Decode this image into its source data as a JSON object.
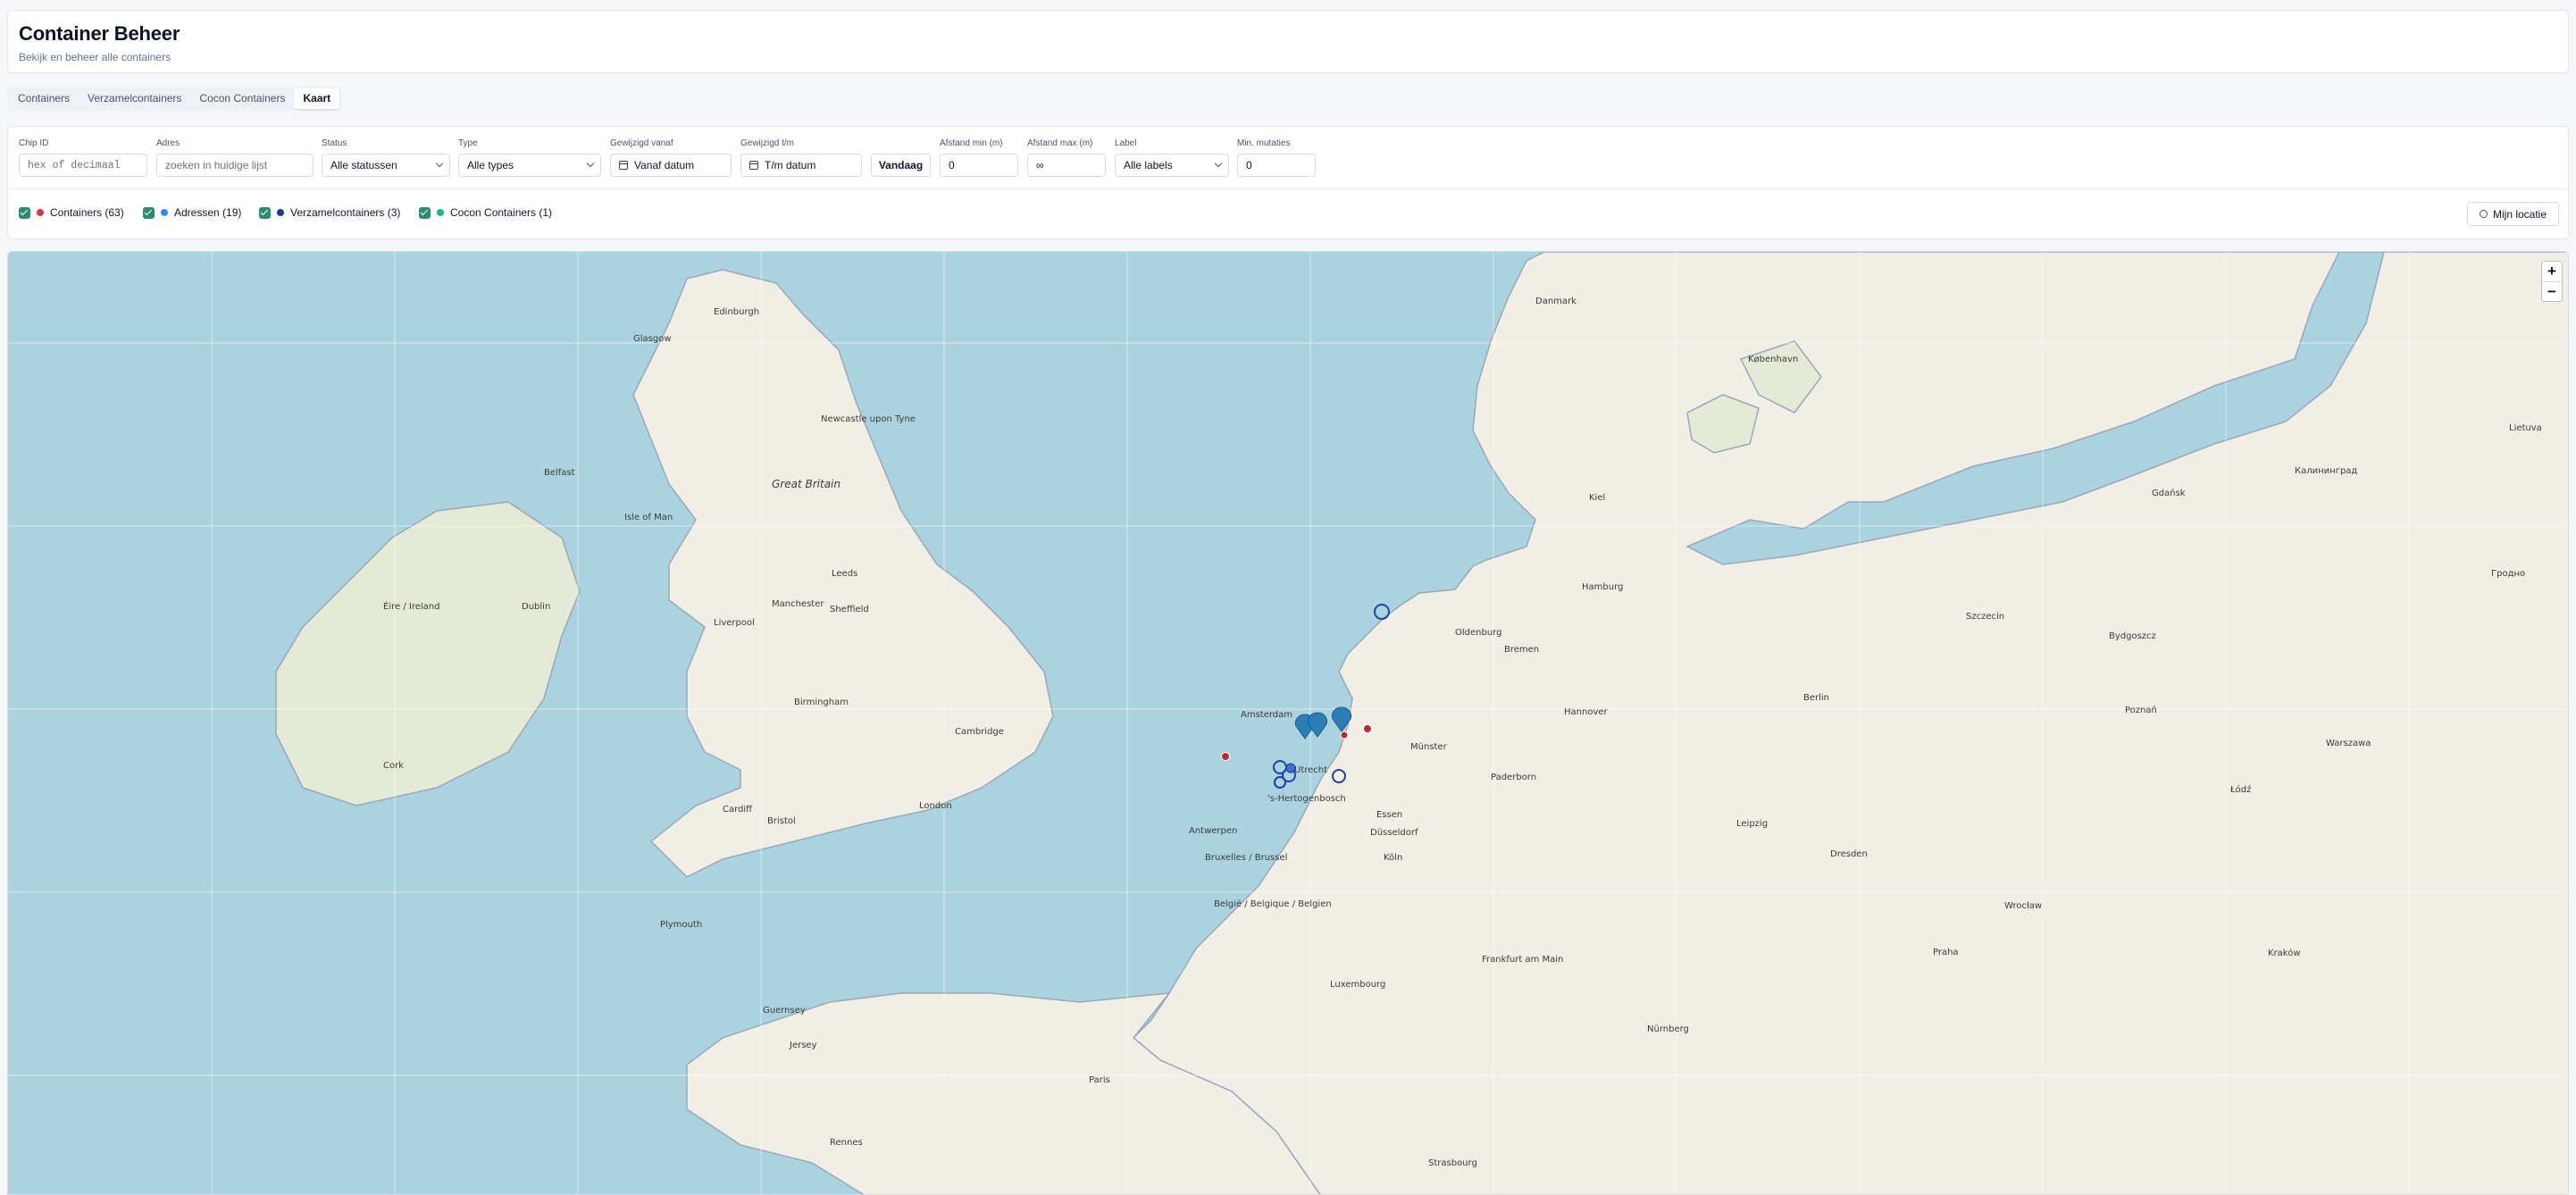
{
  "header": {
    "title": "Container Beheer",
    "subtitle": "Bekijk en beheer alle containers"
  },
  "tabs": [
    {
      "label": "Containers",
      "active": false
    },
    {
      "label": "Verzamelcontainers",
      "active": false
    },
    {
      "label": "Cocon Containers",
      "active": false
    },
    {
      "label": "Kaart",
      "active": true
    }
  ],
  "filters": {
    "chip_id": {
      "label": "Chip ID",
      "placeholder": "hex of decimaal"
    },
    "adres": {
      "label": "Adres",
      "placeholder": "zoeken in huidige lijst"
    },
    "status": {
      "label": "Status",
      "value": "Alle statussen"
    },
    "type": {
      "label": "Type",
      "value": "Alle types"
    },
    "gewijzigd_vanaf": {
      "label": "Gewijzigd vanaf",
      "value": "Vanaf datum"
    },
    "gewijzigd_tm": {
      "label": "Gewijzigd t/m",
      "value": "T/m datum"
    },
    "vandaag": "Vandaag",
    "afstand_min": {
      "label": "Afstand min (m)",
      "value": "0"
    },
    "afstand_max": {
      "label": "Afstand max (m)",
      "value": "∞"
    },
    "label": {
      "label": "Label",
      "value": "Alle labels"
    },
    "min_mutaties": {
      "label": "Min. mutaties",
      "value": "0"
    }
  },
  "layers": [
    {
      "label": "Containers (63)",
      "color": "#dc3545",
      "checked": true
    },
    {
      "label": "Adressen (19)",
      "color": "#3b82f6",
      "checked": true
    },
    {
      "label": "Verzamelcontainers (3)",
      "color": "#1e3a8a",
      "checked": true
    },
    {
      "label": "Cocon Containers (1)",
      "color": "#10b981",
      "checked": true
    }
  ],
  "location_button": "Mijn locatie",
  "map": {
    "zoom_in": "+",
    "zoom_out": "−",
    "place_labels": {
      "great_britain": "Great Britain",
      "eire": "Éire / Ireland",
      "danmark": "Danmark",
      "edinburgh": "Edinburgh",
      "glasgow": "Glasgow",
      "newcastle": "Newcastle upon Tyne",
      "belfast": "Belfast",
      "dublin": "Dublin",
      "isle_of_man": "Isle of Man",
      "manchester": "Manchester",
      "liverpool": "Liverpool",
      "leeds": "Leeds",
      "sheffield": "Sheffield",
      "birmingham": "Birmingham",
      "london": "London",
      "cambridge": "Cambridge",
      "cardiff": "Cardiff",
      "bristol": "Bristol",
      "plymouth": "Plymouth",
      "cork": "Cork",
      "amsterdam": "Amsterdam",
      "utrecht": "Utrecht",
      "hertogenbosch": "'s-Hertogenbosch",
      "brussel": "Bruxelles / Brussel",
      "belgie": "België / Belgique / Belgien",
      "antwerpen": "Antwerpen",
      "luxembourg": "Luxembourg",
      "paris": "Paris",
      "rennes": "Rennes",
      "jersey": "Jersey",
      "guernsey": "Guernsey",
      "hamburg": "Hamburg",
      "bremen": "Bremen",
      "hannover": "Hannover",
      "berlin": "Berlin",
      "dusseldorf": "Düsseldorf",
      "essen": "Essen",
      "koln": "Köln",
      "frankfurt": "Frankfurt am Main",
      "leipzig": "Leipzig",
      "dresden": "Dresden",
      "nurnberg": "Nürnberg",
      "praha": "Praha",
      "strasbourg": "Strasbourg",
      "kobenhavn": "København",
      "szczecin": "Szczecin",
      "bydgoszcz": "Bydgoszcz",
      "warszawa": "Warszawa",
      "poznan": "Poznań",
      "wroclaw": "Wrocław",
      "krakow": "Kraków",
      "lodz": "Łódź",
      "gdansk": "Gdańsk",
      "kaliningrad": "Калининград",
      "lietuva": "Lietuva",
      "grodno": "Гродно",
      "oldenburg": "Oldenburg",
      "kiel": "Kiel",
      "munster": "Münster",
      "paderborn": "Paderborn"
    }
  }
}
